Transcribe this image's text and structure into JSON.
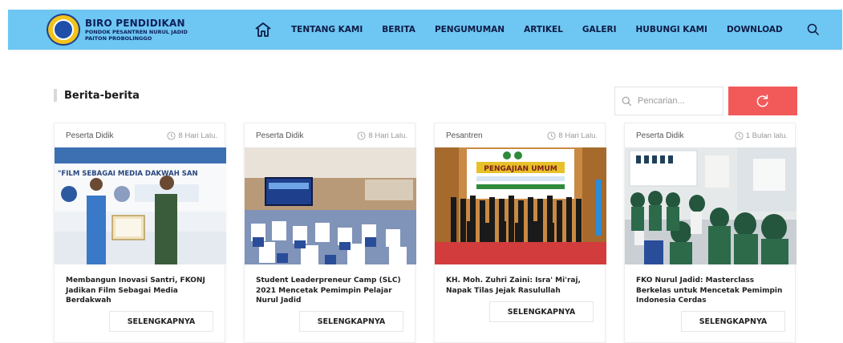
{
  "brand": {
    "title": "BIRO PENDIDIKAN",
    "subtitle_1": "PONDOK PESANTREN NURUL JADID",
    "subtitle_2": "PAITON PROBOLINGGO"
  },
  "nav": {
    "home_icon": "home-icon",
    "items": [
      "TENTANG KAMI",
      "BERITA",
      "PENGUMUMAN",
      "ARTIKEL",
      "GALERI",
      "HUBUNGI KAMI",
      "DOWNLOAD"
    ],
    "search_icon": "search-icon"
  },
  "section": {
    "title": "Berita-berita"
  },
  "search": {
    "placeholder": "Pencarian...",
    "refresh_icon": "refresh-icon"
  },
  "colors": {
    "header": "#6ec6f2",
    "refresh": "#f25a5a",
    "nav_text": "#0d1b45"
  },
  "cards": [
    {
      "category": "Peserta Didik",
      "time": "8 Hari Lalu.",
      "image_banner": "\"FILM SEBAGAI MEDIA DAKWAH SAN",
      "title": "Membangun Inovasi Santri, FKONJ Jadikan Film Sebagai Media Berdakwah",
      "button": "SELENGKAPNYA"
    },
    {
      "category": "Peserta Didik",
      "time": "8 Hari Lalu.",
      "title": "Student Leaderpreneur Camp (SLC) 2021 Mencetak Pemimpin Pelajar Nurul Jadid",
      "button": "SELENGKAPNYA"
    },
    {
      "category": "Pesantren",
      "time": "8 Hari Lalu.",
      "image_banner": "PENGAJIAN UMUM",
      "title": "KH. Moh. Zuhri Zaini: Isra' Mi'raj, Napak Tilas Jejak Rasulullah",
      "button": "SELENGKAPNYA"
    },
    {
      "category": "Peserta Didik",
      "time": "1 Bulan lalu.",
      "title": "FKO Nurul Jadid: Masterclass Berkelas untuk Mencetak Pemimpin Indonesia Cerdas",
      "button": "SELENGKAPNYA"
    }
  ]
}
